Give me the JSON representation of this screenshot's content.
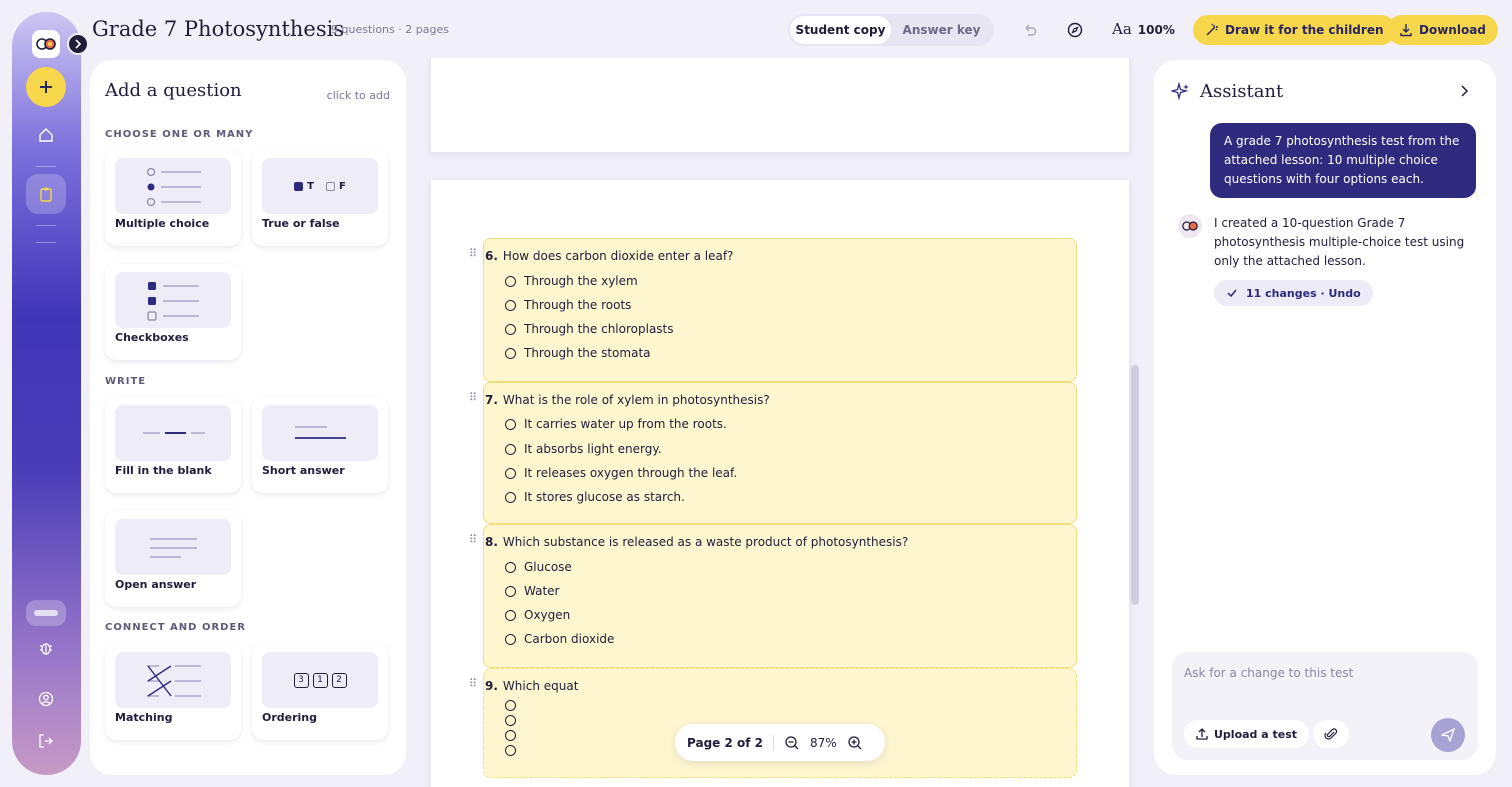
{
  "doc": {
    "title": "Grade 7 Photosynthesis",
    "meta": "9 questions · 2 pages"
  },
  "toolbar": {
    "student_copy": "Student copy",
    "answer_key": "Answer key",
    "font_glyph": "Aa",
    "zoom": "100%",
    "draw_label": "Draw it for the children",
    "download_label": "Download"
  },
  "add_panel": {
    "title": "Add a question",
    "hint": "click to add",
    "sections": {
      "choose": "CHOOSE ONE OR MANY",
      "write": "WRITE",
      "connect": "CONNECT AND ORDER"
    },
    "types": {
      "multiple_choice": "Multiple choice",
      "true_false": "True or false",
      "checkboxes": "Checkboxes",
      "fill_blank": "Fill in the blank",
      "short_answer": "Short answer",
      "open_answer": "Open answer",
      "matching": "Matching",
      "ordering": "Ordering"
    },
    "tf_labels": {
      "t": "T",
      "f": "F"
    },
    "ordering_nums": [
      "3",
      "1",
      "2"
    ]
  },
  "questions": [
    {
      "num": "6.",
      "text": "How does carbon dioxide enter a leaf?",
      "options": [
        "Through the xylem",
        "Through the roots",
        "Through the chloroplasts",
        "Through the stomata"
      ]
    },
    {
      "num": "7.",
      "text": "What is the role of xylem in photosynthesis?",
      "options": [
        "It carries water up from the roots.",
        "It absorbs light energy.",
        "It releases oxygen through the leaf.",
        "It stores glucose as starch."
      ]
    },
    {
      "num": "8.",
      "text": "Which substance is released as a waste product of photosynthesis?",
      "options": [
        "Glucose",
        "Water",
        "Oxygen",
        "Carbon dioxide"
      ]
    },
    {
      "num": "9.",
      "text": "Which equat",
      "options": [
        "",
        "",
        "",
        ""
      ]
    }
  ],
  "pager": {
    "label": "Page 2 of 2",
    "zoom": "87%"
  },
  "assistant": {
    "title": "Assistant",
    "user_message": "A grade 7 photosynthesis test from the attached lesson: 10 multiple choice questions with four options each.",
    "reply": "I created a 10-question Grade 7 photosynthesis multiple-choice test using only the attached lesson.",
    "changes_chip": "11 changes · Undo",
    "composer_placeholder": "Ask for a change to this test",
    "upload_label": "Upload a test"
  },
  "colors": {
    "accent": "#2e2a7e",
    "highlight": "#fef6cf",
    "yellow": "#f6d64a"
  }
}
